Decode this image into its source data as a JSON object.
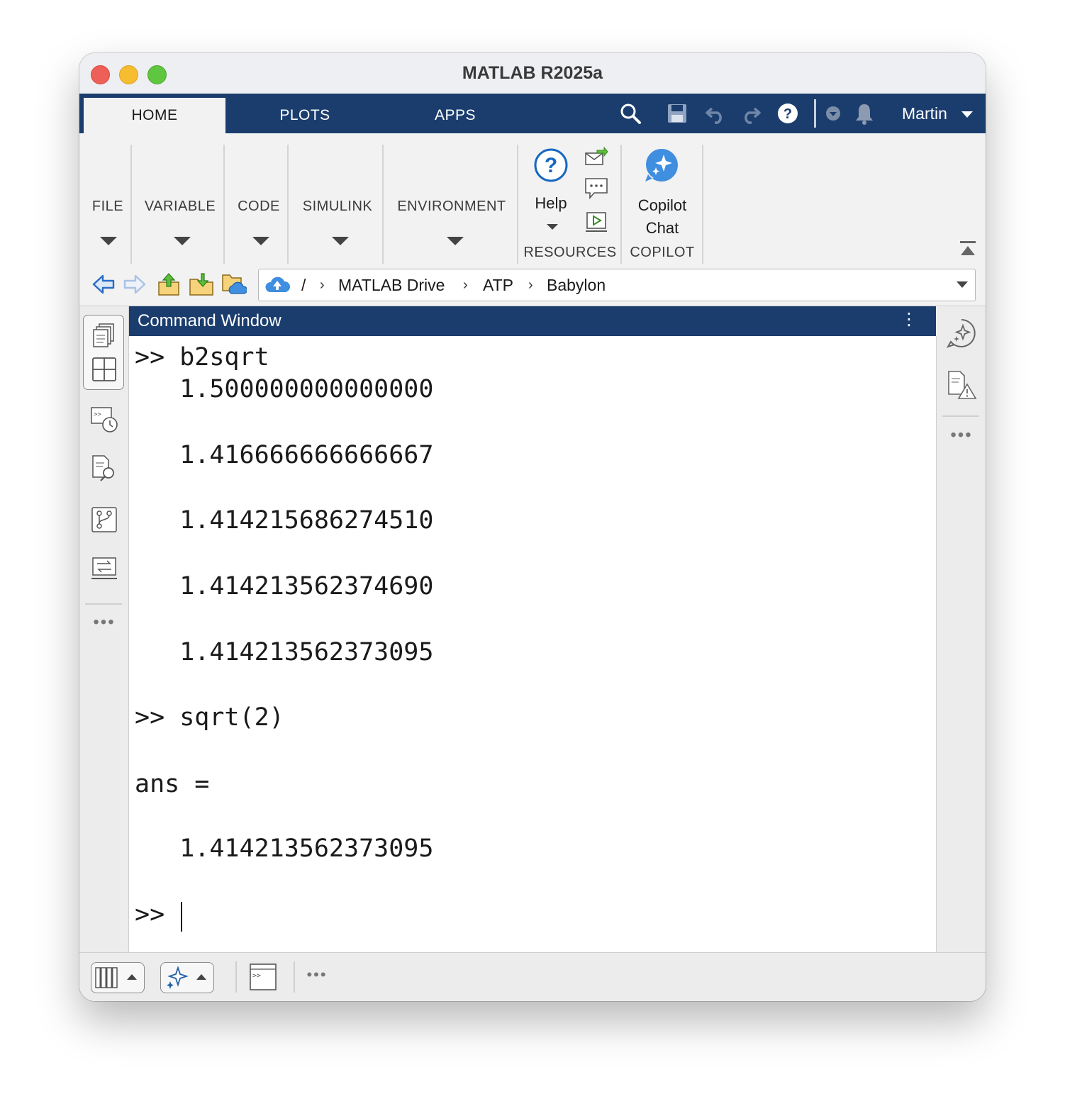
{
  "window": {
    "title": "MATLAB R2025a"
  },
  "tabs": [
    {
      "label": "HOME",
      "active": true
    },
    {
      "label": "PLOTS",
      "active": false
    },
    {
      "label": "APPS",
      "active": false
    }
  ],
  "quick_access": {
    "user": "Martin"
  },
  "ribbon": {
    "sections": [
      "FILE",
      "VARIABLE",
      "CODE",
      "SIMULINK",
      "ENVIRONMENT"
    ],
    "help_label": "Help",
    "copilot_label_1": "Copilot",
    "copilot_label_2": "Chat",
    "resources_group": "RESOURCES",
    "copilot_group": "COPILOT"
  },
  "address": {
    "root": "/",
    "crumbs": [
      "MATLAB Drive",
      "ATP",
      "Babylon"
    ]
  },
  "command_window": {
    "title": "Command Window",
    "lines": [
      ">> b2sqrt",
      "   1.500000000000000",
      "   1.416666666666667",
      "   1.414215686274510",
      "   1.414213562374690",
      "   1.414213562373095",
      ">> sqrt(2)",
      "ans =",
      "   1.414213562373095",
      ">> "
    ]
  },
  "colors": {
    "accent": "#1b3d6e",
    "help_blue": "#1668c1",
    "copilot_blue": "#3f8ee0"
  }
}
